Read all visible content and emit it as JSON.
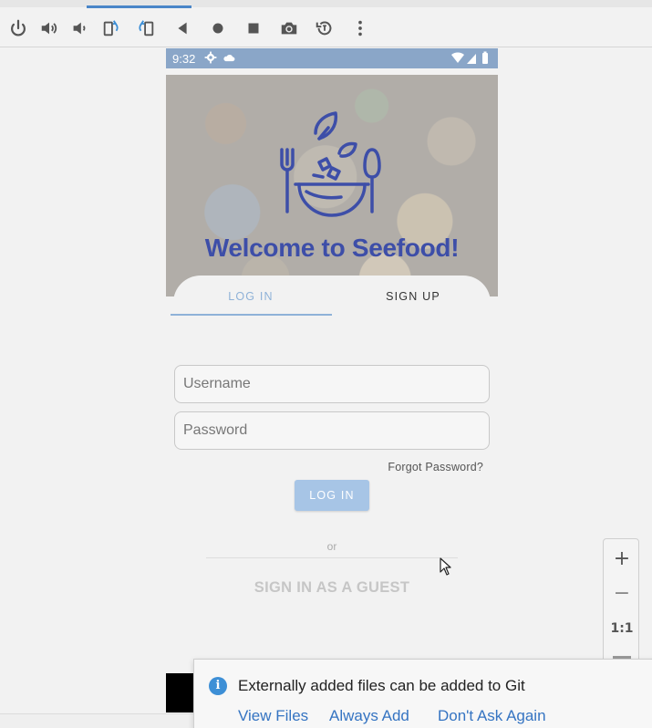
{
  "toolbar": {
    "icons": [
      "power-icon",
      "volume-up-icon",
      "volume-down-icon",
      "rotate-left-icon",
      "rotate-right-icon",
      "back-icon",
      "home-icon",
      "overview-icon",
      "camera-icon",
      "snapshot-icon",
      "more-icon"
    ]
  },
  "statusbar": {
    "time": "9:32"
  },
  "app": {
    "title": "Welcome to Seefood!",
    "tabs": [
      {
        "label": "LOG IN",
        "active": true
      },
      {
        "label": "SIGN UP",
        "active": false
      }
    ],
    "username_placeholder": "Username",
    "password_placeholder": "Password",
    "forgot_label": "Forgot Password?",
    "login_label": "LOG IN",
    "or_label": "or",
    "guest_label": "SIGN IN AS A GUEST"
  },
  "zoom": {
    "in_label": "+",
    "out_label": "−",
    "fit_label": "1:1"
  },
  "notification": {
    "message": "Externally added files can be added to Git",
    "actions": [
      "View Files",
      "Always Add",
      "Don't Ask Again"
    ]
  },
  "colors": {
    "accent": "#8fb2d8",
    "title": "#3d4ea8",
    "statusbar": "#8aa6c8",
    "link": "#3574c2"
  }
}
